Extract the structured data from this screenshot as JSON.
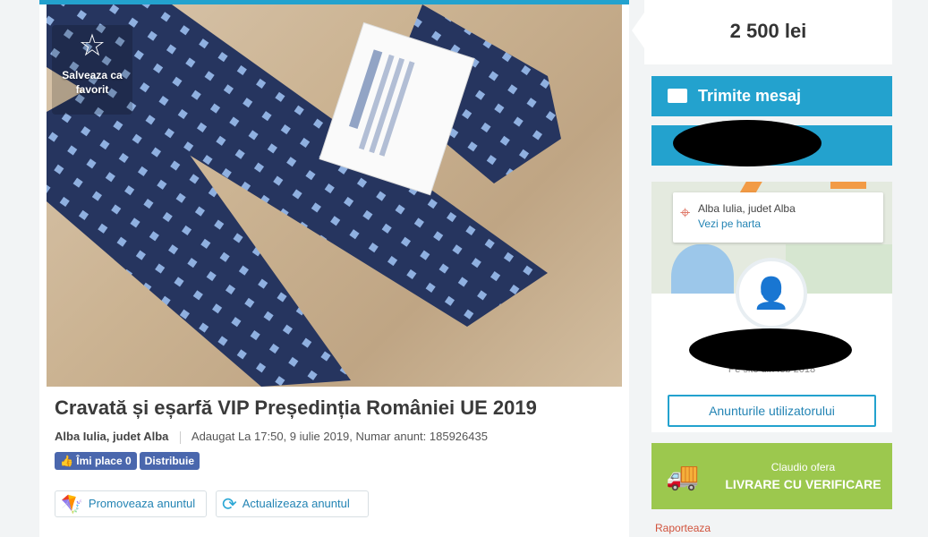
{
  "favorite": {
    "icon": "star-outline-icon",
    "label": "Salveaza ca favorit"
  },
  "listing": {
    "title": "Cravată și eșarfă VIP Președinția României UE 2019",
    "location": "Alba Iulia, judet Alba",
    "added": "Adaugat La 17:50, 9 iulie 2019, Numar anunt: 185926435"
  },
  "social": {
    "like": "Îmi place 0",
    "share": "Distribuie"
  },
  "actions": {
    "promote": "Promoveaza anuntul",
    "refresh": "Actualizeaza anuntul"
  },
  "price": "2 500 lei",
  "contact": {
    "message": "Trimite mesaj"
  },
  "map_card": {
    "city": "Alba Iulia, judet Alba",
    "map_link": "Vezi pe harta"
  },
  "user": {
    "since": "Pe site din feb 2018",
    "ads_button": "Anunturile utilizatorului"
  },
  "delivery": {
    "line1": "Claudio ofera",
    "line2": "LIVRARE CU VERIFICARE"
  },
  "report": "Raporteaza",
  "colors": {
    "accent": "#23a2ce",
    "delivery": "#9cc84e",
    "report": "#d1533d"
  }
}
